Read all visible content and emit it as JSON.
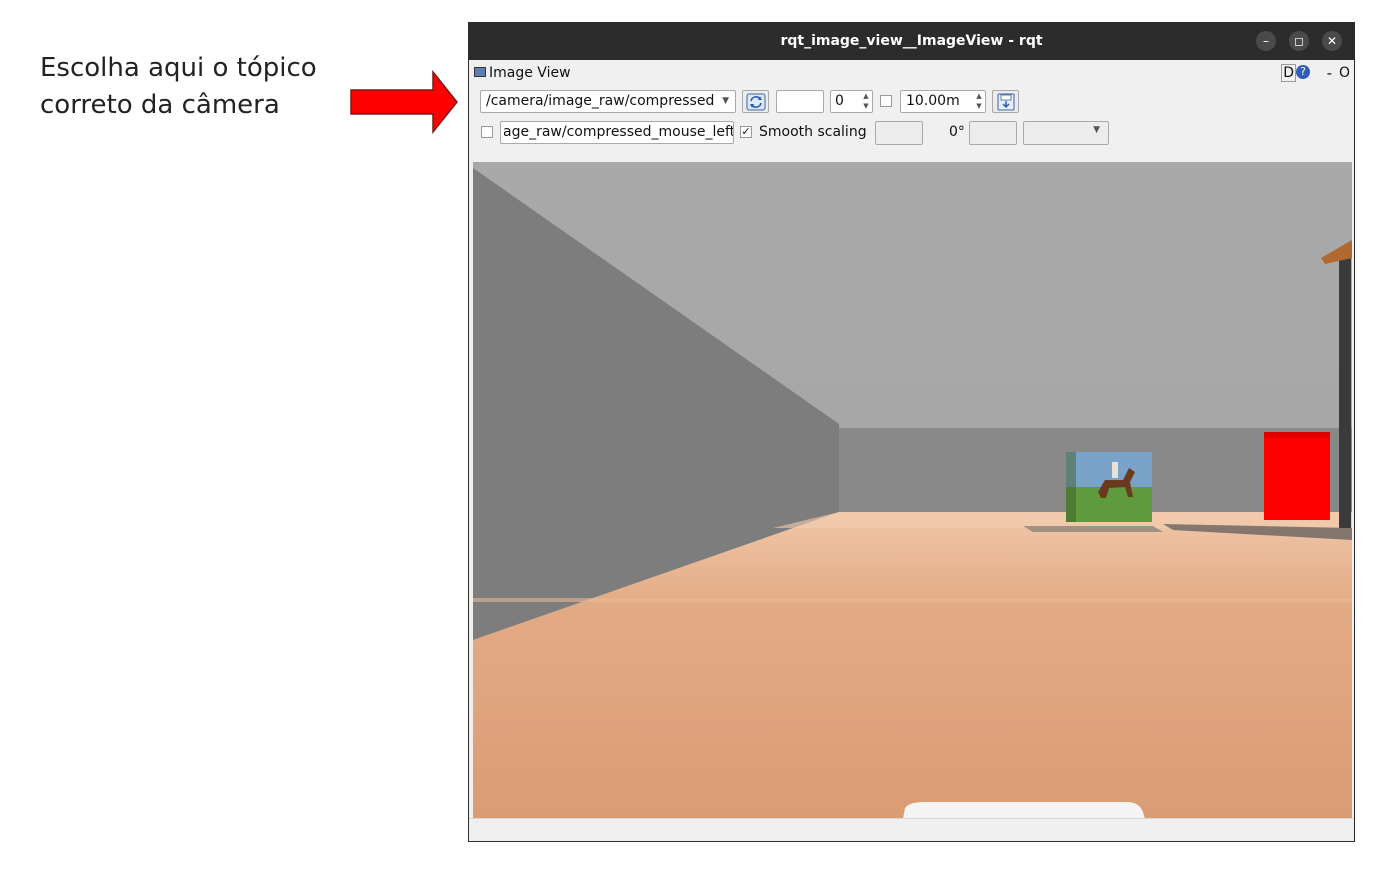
{
  "annotation": {
    "line1": "Escolha aqui o tópico",
    "line2": "correto da câmera",
    "arrow_color": "#ff0000"
  },
  "window": {
    "title": "rqt_image_view__ImageView - rqt",
    "minimize_icon": "minimize-icon",
    "maximize_icon": "maximize-icon",
    "close_icon": "close-icon"
  },
  "plugin_header": {
    "title": "Image View",
    "d_label": "D",
    "help_label": "?",
    "minus_label": "-",
    "close_label": "O"
  },
  "toolbar": {
    "topic_value": "/camera/image_raw/compressed",
    "refresh_icon": "refresh-icon",
    "blank_field": "",
    "spin_value": "0",
    "limit_enabled": false,
    "range_value": "10.00m",
    "save_icon": "save-icon"
  },
  "toolbar2": {
    "publish_enabled": false,
    "mouse_topic_value": "age_raw/compressed_mouse_left",
    "smooth_scaling_checked": true,
    "smooth_scaling_label": "Smooth scaling",
    "rotation_label": "0°",
    "blank_field_1": "",
    "blank_field_2": "",
    "blank_combo": ""
  },
  "colors": {
    "titlebar": "#2c2c2c",
    "window_bg": "#f0f0f0",
    "wall_left": "#7d7d7d",
    "wall_back": "#898989",
    "floor": "#e0a47c",
    "red_box": "#ff0000"
  }
}
